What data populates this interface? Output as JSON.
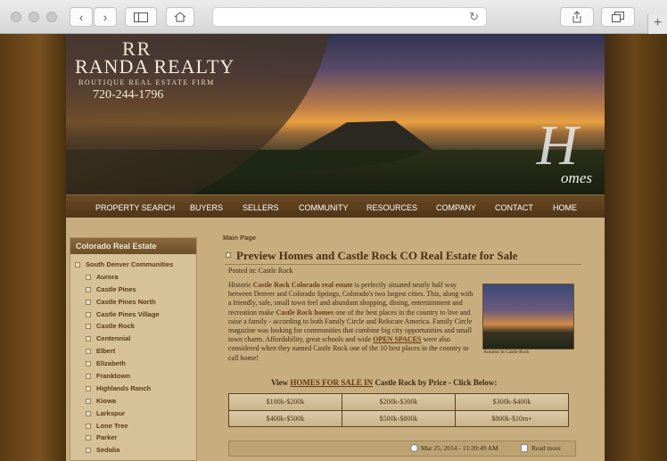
{
  "browser": {
    "back_icon": "‹",
    "forward_icon": "›",
    "sidebar_icon": "sidebar-icon",
    "home_icon": "home-icon",
    "reload_icon": "↻",
    "share_icon": "share-icon",
    "tabs_icon": "tabs-icon",
    "new_tab": "+"
  },
  "banner": {
    "logo_mark": "RR",
    "logo_text": "RANDA REALTY",
    "tagline": "BOUTIQUE REAL ESTATE FIRM",
    "phone": "720-244-1796",
    "homes_initial": "H",
    "homes_word": "omes"
  },
  "nav": [
    "PROPERTY SEARCH",
    "BUYERS",
    "SELLERS",
    "COMMUNITY",
    "RESOURCES",
    "COMPANY",
    "CONTACT",
    "HOME"
  ],
  "sidebar": {
    "heading": "Colorado Real Estate",
    "parent": "South Denver Communities",
    "items": [
      "Aurora",
      "Castle Pines",
      "Castle Pines North",
      "Castle Pines Village",
      "Castle Rock",
      "Centennial",
      "Elbert",
      "Elizabeth",
      "Franktown",
      "Highlands Ranch",
      "Kiowa",
      "Larkspur",
      "Lone Tree",
      "Parker",
      "Sedalia"
    ]
  },
  "main": {
    "breadcrumb": "Main Page",
    "title": "Preview Homes and Castle Rock CO Real Estate for Sale",
    "posted": "Posted in: Castle Rock",
    "para_1": "Historic ",
    "link_1": "Castle Rock Colorado real estate",
    "para_2": " is perfectly situated nearly half way between Denver and Colorado Springs, Colorado's two largest cities. This, along with a friendly, safe, small town feel and abundant shopping, dining, entertainment and recreation make ",
    "link_2": "Castle Rock homes",
    "para_3": " one of the best places in the country to live and raise a family - according to both Family Circle and Relocate America. Family Circle magazine was looking for communities that combine big city opportunities and small town charm. Affordability, great schools and wide ",
    "link_3": "OPEN SPACES",
    "para_4": " were also considered when they named Castle Rock one of the 10 best places in the country to call home!",
    "photo_caption": "Autumn in Castle Rock",
    "view_prefix": "View ",
    "view_link": "HOMES FOR SALE IN",
    "view_suffix": " Castle Rock by Price - Click Below:",
    "prices": [
      "$100k-$200k",
      "$200k-$300k",
      "$300k-$400k",
      "$400k-$500k",
      "$500k-$800k",
      "$800k-$10m+"
    ],
    "date": "Mar 25, 2014 - 11:39:49 AM",
    "read_more": "Read more"
  }
}
